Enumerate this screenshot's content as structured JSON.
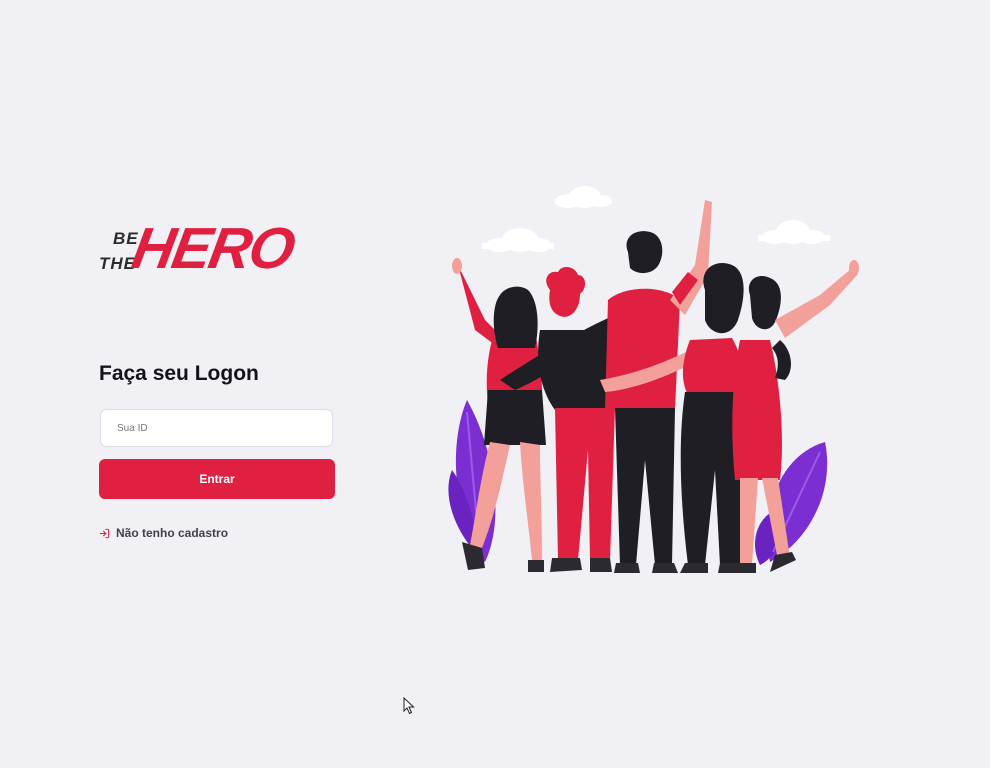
{
  "logo": {
    "be": "BE",
    "the": "THE",
    "hero": "HERO"
  },
  "form": {
    "title": "Faça seu Logon",
    "id_placeholder": "Sua ID",
    "submit_label": "Entrar",
    "register_label": "Não tenho cadastro"
  },
  "colors": {
    "background": "#f0f0f5",
    "brand": "#e02041",
    "text_dark": "#13131a",
    "leaf_purple": "#7b2fd3"
  },
  "icons": {
    "register": "log-in-icon",
    "cursor": "mouse-cursor-icon"
  }
}
